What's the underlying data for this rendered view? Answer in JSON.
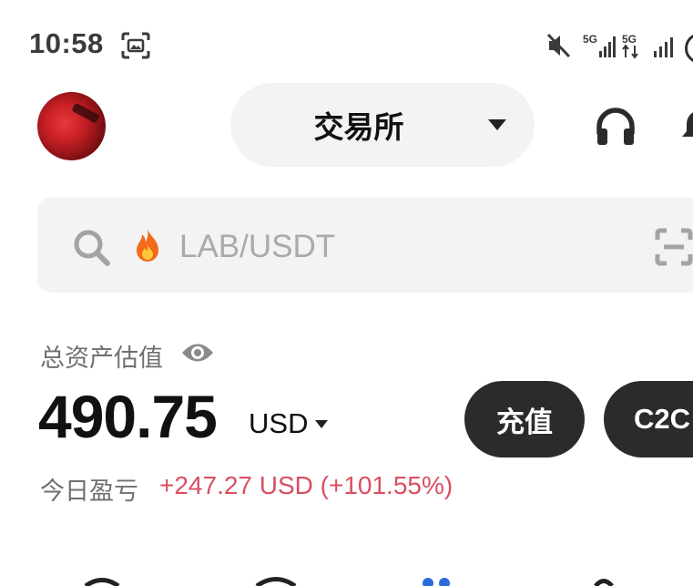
{
  "status_bar": {
    "time": "10:58",
    "icons": [
      "screenshot-icon",
      "mute-icon",
      "signal-5g-icon",
      "signal-5g-data-icon",
      "signal-icon",
      "camera-cutout"
    ],
    "net1": "5G",
    "net2": "5G"
  },
  "header": {
    "exchange_label": "交易所",
    "icons": [
      "avatar",
      "headset-icon",
      "bell-icon"
    ]
  },
  "search": {
    "placeholder": "LAB/USDT",
    "icons": [
      "search-icon",
      "fire-icon",
      "scan-icon"
    ]
  },
  "assets": {
    "label": "总资产估值",
    "value": "490.75",
    "currency": "USD",
    "deposit_button": "充值",
    "c2c_button": "C2C",
    "pnl_label": "今日盈亏",
    "pnl_value": "+247.27 USD (+101.55%)"
  },
  "colors": {
    "accent_positive": "#d94f63",
    "button_dark": "#2b2b2b",
    "pill_bg": "#f3f3f3"
  }
}
